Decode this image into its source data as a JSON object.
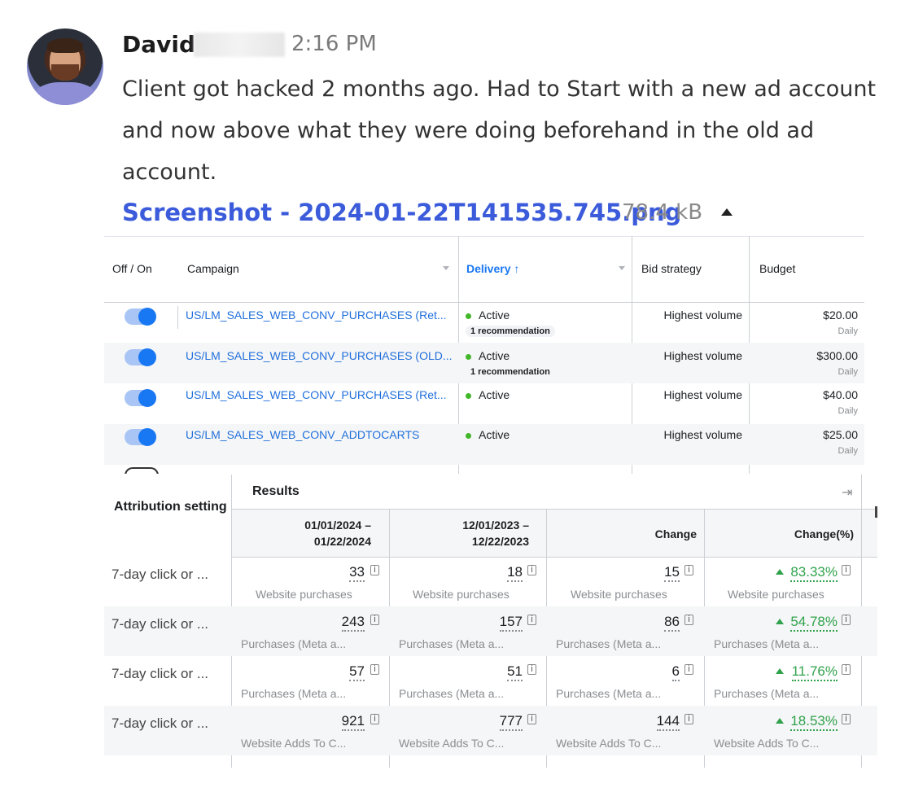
{
  "message": {
    "author": "David",
    "time": "2:16 PM",
    "text": "Client got hacked 2 months ago. Had to Start with a new ad account and now above what they were doing beforehand in the old ad account.",
    "attachment": {
      "name": "Screenshot - 2024-01-22T141535.745.png",
      "size": "78.4 kB"
    }
  },
  "campaigns_table": {
    "headers": {
      "toggle": "Off / On",
      "campaign": "Campaign",
      "delivery": "Delivery ↑",
      "bid": "Bid strategy",
      "budget": "Budget"
    },
    "rows": [
      {
        "name": "US/LM_SALES_WEB_CONV_PURCHASES (Ret...",
        "status": "Active",
        "rec": "1 recommendation",
        "bid": "Highest volume",
        "budget": "$20.00",
        "period": "Daily"
      },
      {
        "name": "US/LM_SALES_WEB_CONV_PURCHASES (OLD...",
        "status": "Active",
        "rec": "1 recommendation",
        "bid": "Highest volume",
        "budget": "$300.00",
        "period": "Daily"
      },
      {
        "name": "US/LM_SALES_WEB_CONV_PURCHASES (Ret...",
        "status": "Active",
        "rec": "",
        "bid": "Highest volume",
        "budget": "$40.00",
        "period": "Daily"
      },
      {
        "name": "US/LM_SALES_WEB_CONV_ADDTOCARTS",
        "status": "Active",
        "rec": "",
        "bid": "Highest volume",
        "budget": "$25.00",
        "period": "Daily"
      }
    ]
  },
  "results_table": {
    "attribution_header": "Attribution setting",
    "results_header": "Results",
    "col_headers": [
      "01/01/2024 –\n01/22/2024",
      "12/01/2023 –\n12/22/2023",
      "Change",
      "Change(%)"
    ],
    "rows": [
      {
        "attr": "7-day click or ...",
        "a": "33",
        "b": "18",
        "c": "15",
        "pct": "83.33%",
        "desc": "Website purchases"
      },
      {
        "attr": "7-day click or ...",
        "a": "243",
        "b": "157",
        "c": "86",
        "pct": "54.78%",
        "desc": "Purchases (Meta a..."
      },
      {
        "attr": "7-day click or ...",
        "a": "57",
        "b": "51",
        "c": "6",
        "pct": "11.76%",
        "desc": "Purchases (Meta a..."
      },
      {
        "attr": "7-day click or ...",
        "a": "921",
        "b": "777",
        "c": "144",
        "pct": "18.53%",
        "desc": "Website Adds To C..."
      }
    ]
  },
  "colors": {
    "link": "#3b5bdb",
    "fb_blue": "#1877f2",
    "green": "#31a24c"
  }
}
